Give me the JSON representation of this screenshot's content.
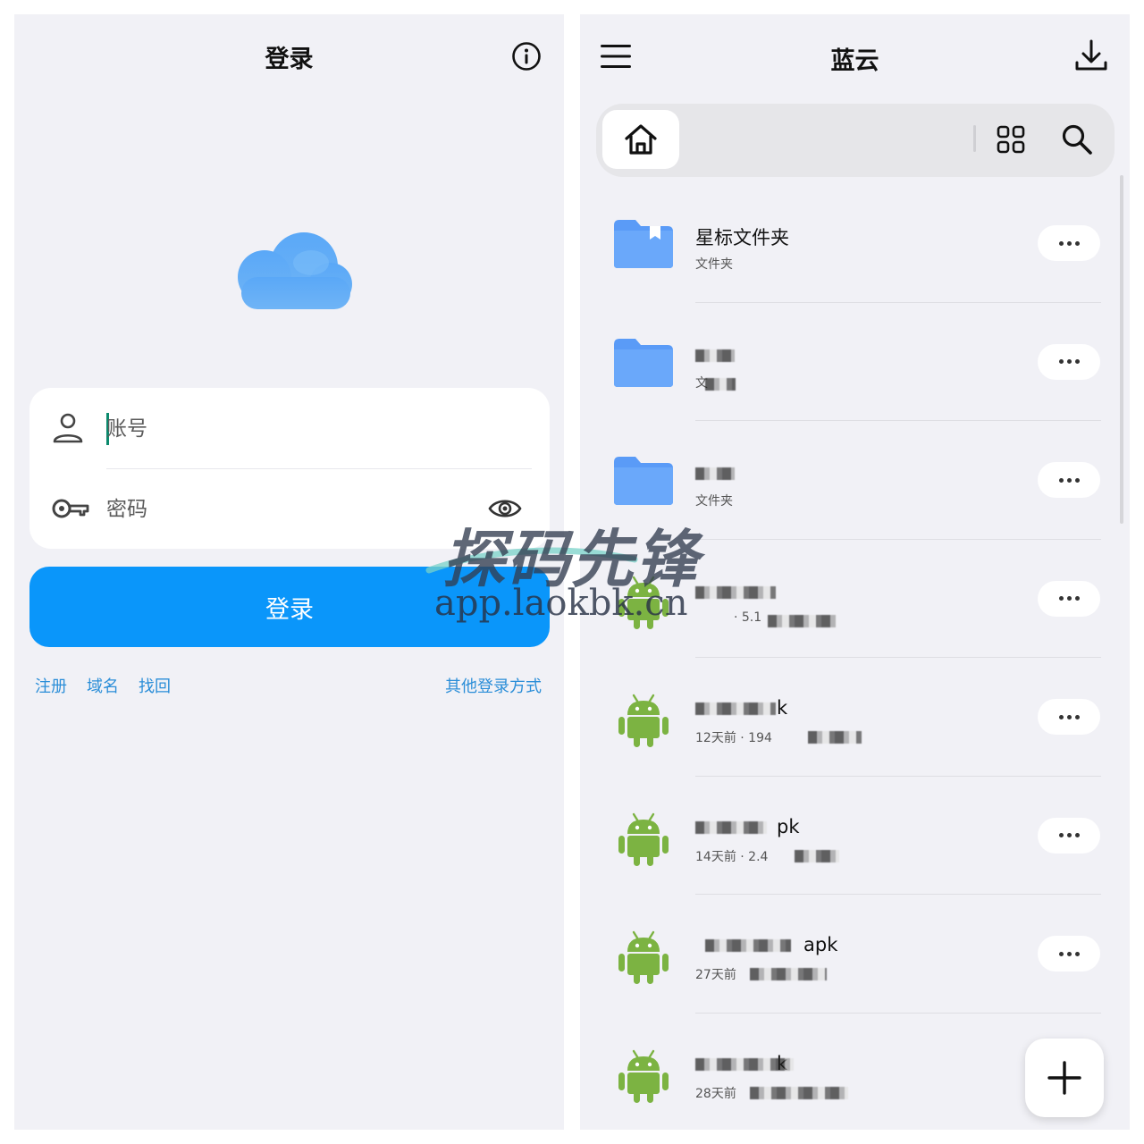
{
  "login": {
    "title": "登录",
    "account_placeholder": "账号",
    "password_placeholder": "密码",
    "login_button": "登录",
    "links": {
      "register": "注册",
      "domain": "域名",
      "recover": "找回",
      "other_methods": "其他登录方式"
    }
  },
  "watermark": {
    "title": "探码先锋",
    "url": "app.laokbk.cn"
  },
  "files": {
    "title": "蓝云",
    "items": [
      {
        "name": "星标文件夹",
        "sub": "文件夹",
        "icon": "starred-folder-icon"
      },
      {
        "name": "",
        "sub": "文",
        "icon": "folder-icon"
      },
      {
        "name": "",
        "sub": "文件夹",
        "icon": "folder-icon"
      },
      {
        "name": "",
        "sub": "· 5.1",
        "icon": "android-icon"
      },
      {
        "name": "k",
        "sub": "12天前 · 194",
        "icon": "android-icon"
      },
      {
        "name": "pk",
        "sub": "14天前 · 2.4",
        "icon": "android-icon"
      },
      {
        "name": "apk",
        "sub": "27天前",
        "icon": "android-icon"
      },
      {
        "name": "k",
        "sub": "28天前",
        "icon": "android-icon"
      }
    ]
  },
  "colors": {
    "accent": "#0a96fa",
    "link": "#2b8ed8",
    "folder": "#5a9bf7",
    "android": "#7cb342",
    "background": "#f1f1f6"
  }
}
